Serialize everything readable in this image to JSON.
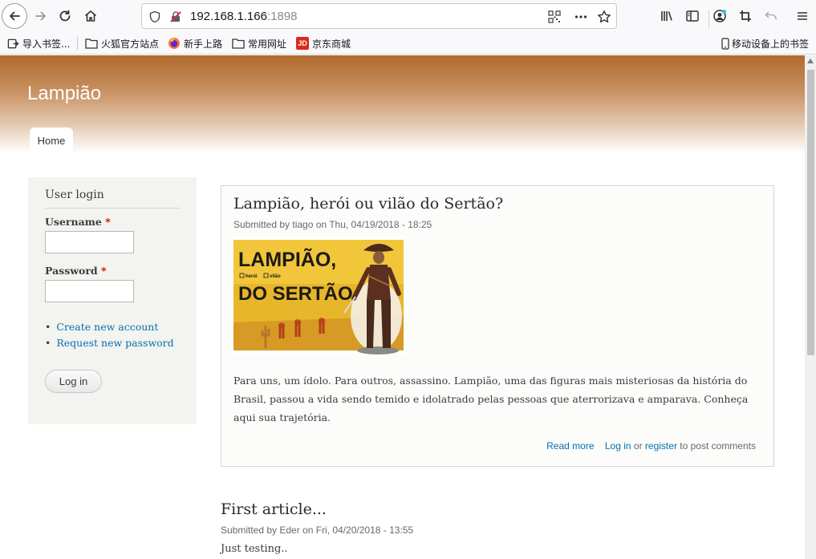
{
  "browser": {
    "url_host": "192.168.1.166",
    "url_port": ":1898",
    "bookmarks": [
      {
        "label": "导入书签..."
      },
      {
        "label": "火狐官方站点"
      },
      {
        "label": "新手上路"
      },
      {
        "label": "常用网址"
      },
      {
        "label": "京东商城"
      }
    ],
    "mobile_bookmarks": "移动设备上的书签",
    "jd_badge": "JD"
  },
  "site": {
    "name": "Lampião",
    "nav": {
      "home": "Home"
    }
  },
  "login_block": {
    "title": "User login",
    "username_label": "Username",
    "password_label": "Password",
    "required_mark": "*",
    "links": {
      "create_account": "Create new account",
      "request_password": "Request new password"
    },
    "login_button": "Log in"
  },
  "articles": [
    {
      "title": "Lampião, herói ou vilão do Sertão?",
      "submitted": "Submitted by tiago on Thu, 04/19/2018 - 18:25",
      "image": {
        "line1": "LAMPIÃO,",
        "opt1": "herói",
        "opt2": "vilão",
        "line2": "DO SERTÃO"
      },
      "body": "Para uns, um ídolo. Para outros, assassino. Lampião, uma das figuras mais misteriosas da história do Brasil, passou a vida sendo temido e idolatrado pelas pessoas que aterrorizava e amparava. Conheça aqui sua trajetória.",
      "read_more": "Read more",
      "login_link": "Log in",
      "or_text": "or",
      "register_link": "register",
      "post_text": "to post comments"
    },
    {
      "title": "First article...",
      "submitted": "Submitted by Eder on Fri, 04/20/2018 - 13:55",
      "body": "Just testing.."
    }
  ]
}
